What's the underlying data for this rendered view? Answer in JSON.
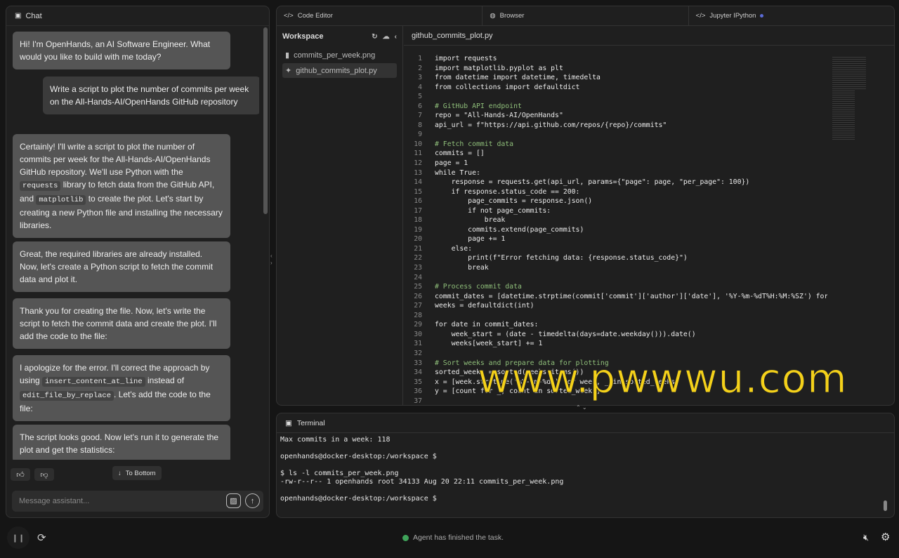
{
  "chat": {
    "title": "Chat",
    "messages": [
      {
        "role": "assistant",
        "segments": [
          {
            "t": "Hi! I'm OpenHands, an AI Software Engineer. What would you like to build with me today?"
          }
        ]
      },
      {
        "role": "user",
        "segments": [
          {
            "t": "Write a script to plot the number of commits per week on the All-Hands-AI/OpenHands GitHub repository"
          }
        ]
      },
      {
        "role": "assistant",
        "segments": [
          {
            "t": "Certainly! I'll write a script to plot the number of commits per week for the All-Hands-AI/OpenHands GitHub repository. We'll use Python with the "
          },
          {
            "t": "requests",
            "code": true
          },
          {
            "t": " library to fetch data from the GitHub API, and "
          },
          {
            "t": "matplotlib",
            "code": true
          },
          {
            "t": " to create the plot. Let's start by creating a new Python file and installing the necessary libraries."
          }
        ]
      },
      {
        "role": "assistant",
        "segments": [
          {
            "t": "Great, the required libraries are already installed. Now, let's create a Python script to fetch the commit data and plot it."
          }
        ]
      },
      {
        "role": "assistant",
        "segments": [
          {
            "t": "Thank you for creating the file. Now, let's write the script to fetch the commit data and create the plot. I'll add the code to the file:"
          }
        ]
      },
      {
        "role": "assistant",
        "segments": [
          {
            "t": "I apologize for the error. I'll correct the approach by using "
          },
          {
            "t": "insert_content_at_line",
            "code": true
          },
          {
            "t": " instead of "
          },
          {
            "t": "edit_file_by_replace",
            "code": true
          },
          {
            "t": ". Let's add the code to the file:"
          }
        ]
      },
      {
        "role": "assistant",
        "segments": [
          {
            "t": "The script looks good. Now let's run it to generate the plot and get the statistics:"
          }
        ]
      }
    ],
    "to_bottom": "To Bottom",
    "input_placeholder": "Message assistant..."
  },
  "tabs": [
    {
      "label": "Code Editor",
      "icon": "code-icon"
    },
    {
      "label": "Browser",
      "icon": "globe-icon"
    },
    {
      "label": "Jupyter IPython",
      "icon": "code-icon"
    }
  ],
  "workspace": {
    "title": "Workspace",
    "files": [
      {
        "name": "commits_per_week.png",
        "icon": "file-icon",
        "selected": false
      },
      {
        "name": "github_commits_plot.py",
        "icon": "python-icon",
        "selected": true
      }
    ]
  },
  "editor": {
    "filename": "github_commits_plot.py",
    "lines": [
      "import requests",
      "import matplotlib.pyplot as plt",
      "from datetime import datetime, timedelta",
      "from collections import defaultdict",
      "",
      "# GitHub API endpoint",
      "repo = \"All-Hands-AI/OpenHands\"",
      "api_url = f\"https://api.github.com/repos/{repo}/commits\"",
      "",
      "# Fetch commit data",
      "commits = []",
      "page = 1",
      "while True:",
      "    response = requests.get(api_url, params={\"page\": page, \"per_page\": 100})",
      "    if response.status_code == 200:",
      "        page_commits = response.json()",
      "        if not page_commits:",
      "            break",
      "        commits.extend(page_commits)",
      "        page += 1",
      "    else:",
      "        print(f\"Error fetching data: {response.status_code}\")",
      "        break",
      "",
      "# Process commit data",
      "commit_dates = [datetime.strptime(commit['commit']['author']['date'], '%Y-%m-%dT%H:%M:%SZ') for commit",
      "weeks = defaultdict(int)",
      "",
      "for date in commit_dates:",
      "    week_start = (date - timedelta(days=date.weekday())).date()",
      "    weeks[week_start] += 1",
      "",
      "# Sort weeks and prepare data for plotting",
      "sorted_weeks = sorted(weeks.items())",
      "x = [week.strftime('%Y-%m-%d') for week, _ in sorted_weeks]",
      "y = [count for _, count in sorted_weeks]",
      ""
    ]
  },
  "terminal": {
    "title": "Terminal",
    "output": "Max commits in a week: 118\n\nopenhands@docker-desktop:/workspace $\n\n$ ls -l commits_per_week.png\n-rw-r--r-- 1 openhands root 34133 Aug 20 22:11 commits_per_week.png\n\nopenhands@docker-desktop:/workspace $"
  },
  "status": {
    "text": "Agent has finished the task.",
    "color": "#3fa35a"
  },
  "watermark": "www.pwwwu.com"
}
